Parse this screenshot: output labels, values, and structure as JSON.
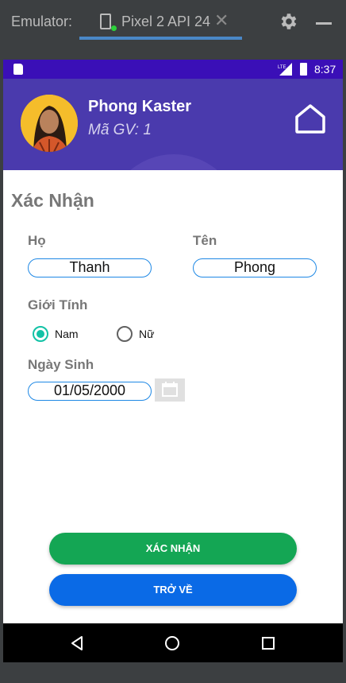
{
  "emulator": {
    "label": "Emulator:",
    "tab_label": "Pixel 2 API 24",
    "close_glyph": "✕"
  },
  "status_bar": {
    "time": "8:37",
    "network": "LTE"
  },
  "header": {
    "name": "Phong Kaster",
    "teacher_id": "Mã GV: 1"
  },
  "form": {
    "title": "Xác Nhận",
    "last_name_label": "Họ",
    "last_name_value": "Thanh",
    "first_name_label": "Tên",
    "first_name_value": "Phong",
    "gender_label": "Giới Tính",
    "gender_options": [
      "Nam",
      "Nữ"
    ],
    "gender_selected": "Nam",
    "birthdate_label": "Ngày Sinh",
    "birthdate_value": "01/05/2000"
  },
  "buttons": {
    "confirm": "XÁC NHẬN",
    "back": "TRỞ VỀ"
  },
  "colors": {
    "status_bar": "#3a0fb7",
    "header": "#4a3aad",
    "confirm_button": "#14a654",
    "back_button": "#0a6ae6",
    "radio_accent": "#12c2a6",
    "field_border": "#1e88e5"
  },
  "icons": {
    "emulator_device": "phone-icon",
    "settings": "gear-icon",
    "minimize": "minimize-icon",
    "home": "home-icon",
    "calendar": "calendar-icon",
    "nav_back": "triangle-back-icon",
    "nav_home": "circle-home-icon",
    "nav_recents": "square-recents-icon"
  }
}
